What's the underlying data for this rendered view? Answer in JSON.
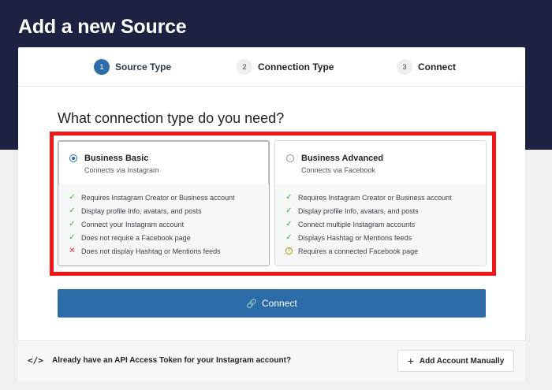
{
  "page": {
    "title": "Add a new Source"
  },
  "stepper": {
    "steps": [
      {
        "number": "1",
        "label": "Source Type",
        "active": true
      },
      {
        "number": "2",
        "label": "Connection Type",
        "active": false
      },
      {
        "number": "3",
        "label": "Connect",
        "active": false
      }
    ]
  },
  "main": {
    "question": "What connection type do you need?",
    "options": [
      {
        "title": "Business Basic",
        "subtitle": "Connects via Instagram",
        "selected": true,
        "features": [
          {
            "icon": "check-icon",
            "text": "Requires Instagram Creator or Business account"
          },
          {
            "icon": "check-icon",
            "text": "Display profile Info, avatars, and posts"
          },
          {
            "icon": "check-icon",
            "text": "Connect your Instagram account"
          },
          {
            "icon": "check-icon",
            "text": "Does not require a Facebook page"
          },
          {
            "icon": "cross-icon",
            "text": "Does not display Hashtag or Mentions feeds"
          }
        ]
      },
      {
        "title": "Business Advanced",
        "subtitle": "Connects via Facebook",
        "selected": false,
        "features": [
          {
            "icon": "check-icon",
            "text": "Requires Instagram Creator or Business account"
          },
          {
            "icon": "check-icon",
            "text": "Display profile Info, avatars, and posts"
          },
          {
            "icon": "check-icon",
            "text": "Connect multiple Instagram accounts"
          },
          {
            "icon": "check-icon",
            "text": "Displays Hashtag or Mentions feeds"
          },
          {
            "icon": "info-icon",
            "text": "Requires a connected Facebook page"
          }
        ]
      }
    ],
    "connect_label": "Connect"
  },
  "footer": {
    "text": "Already have an API Access Token for your Instagram account?",
    "add_label": "Add Account Manually"
  },
  "colors": {
    "header_bg": "#1d2142",
    "accent": "#2c6ca8",
    "highlight": "#f21616",
    "check": "#46a543",
    "cross": "#d63638",
    "info": "#b4890b"
  }
}
